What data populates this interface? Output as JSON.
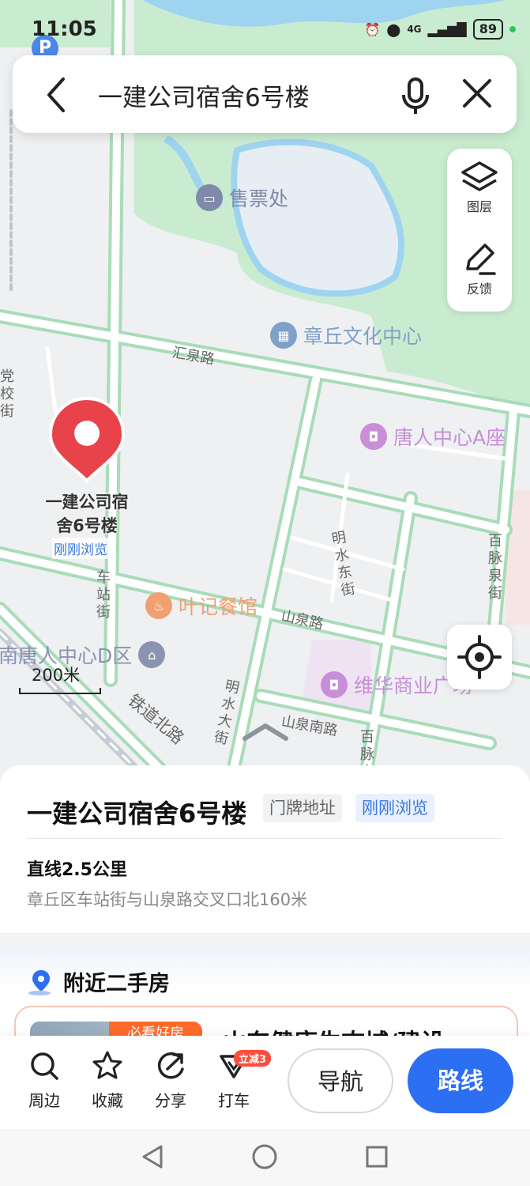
{
  "status_bar": {
    "time": "11:05",
    "network": "4G",
    "battery": "89"
  },
  "search": {
    "query": "一建公司宿舍6号楼"
  },
  "map_tools": {
    "layers_label": "图层",
    "feedback_label": "反馈"
  },
  "map": {
    "pois": [
      {
        "label": "售票处",
        "color": "#7f8aa8"
      },
      {
        "label": "章丘文化中心",
        "color": "#7fa0c8"
      },
      {
        "label": "唐人中心A座",
        "color": "#c88ed8"
      },
      {
        "label": "叶记餐馆",
        "color": "#f0a070"
      },
      {
        "label": "南唐人中心D区",
        "color": "#8a93b0"
      },
      {
        "label": "维华商业广场",
        "color": "#c88ed8"
      }
    ],
    "roads": {
      "huiquan": "汇泉路",
      "shanquan": "山泉路",
      "shanquan_south": "山泉南路",
      "tiedao_north": "铁道北路",
      "chezhan": "车站街",
      "mingshui_east": "明水东街",
      "mingshui_da": "明水大街",
      "baimai_quan": "百脉泉街",
      "baimai": "百脉泉",
      "dangxiao": "党校街"
    },
    "parking": "P",
    "scale": "200米"
  },
  "pin": {
    "name": "一建公司宿舍6号楼",
    "name_line1": "一建公司宿",
    "name_line2": "舍6号楼",
    "badge": "刚刚浏览"
  },
  "place": {
    "name": "一建公司宿舍6号楼",
    "tag_address": "门牌地址",
    "tag_recent": "刚刚浏览",
    "distance": "直线2.5公里",
    "address": "章丘区车站街与山泉路交叉口北160米"
  },
  "nearby": {
    "header": "附近二手房",
    "card": {
      "badge": "必看好房",
      "title": "山东健康生态城/建设"
    }
  },
  "toolbar": {
    "nearby": "周边",
    "favorite": "收藏",
    "share": "分享",
    "taxi": "打车",
    "taxi_promo": "立减3",
    "navigate": "导航",
    "route": "路线"
  },
  "colors": {
    "accent": "#2d6ff2",
    "pin": "#e8434b",
    "park": "#bfe6c6",
    "road_edge": "#a8dcb8"
  }
}
